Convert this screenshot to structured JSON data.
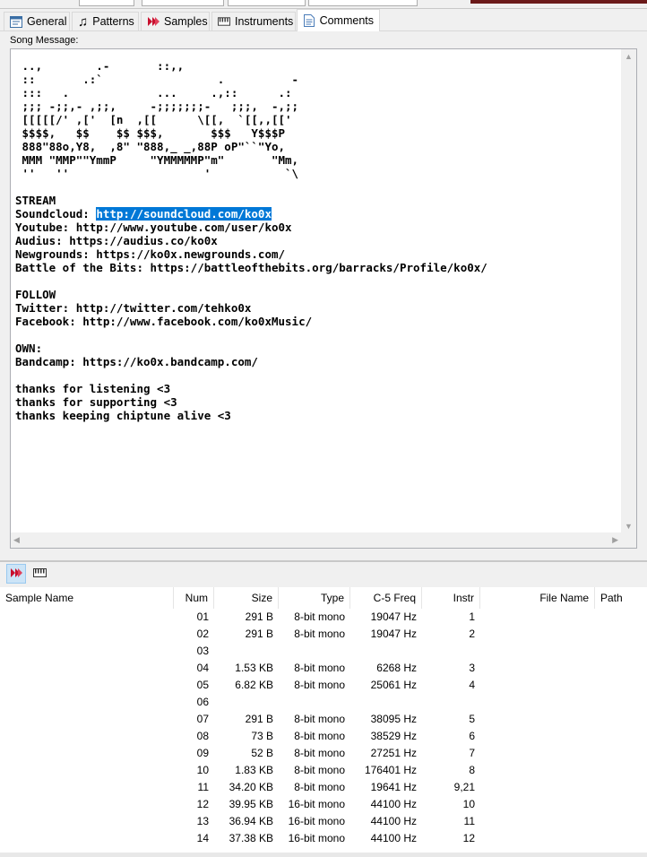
{
  "tabs": [
    {
      "label": "General",
      "icon": "general-icon",
      "active": false
    },
    {
      "label": "Patterns",
      "icon": "music-note-icon",
      "active": false
    },
    {
      "label": "Samples",
      "icon": "samples-icon",
      "active": false
    },
    {
      "label": "Instruments",
      "icon": "piano-icon",
      "active": false
    },
    {
      "label": "Comments",
      "icon": "document-icon",
      "active": true
    }
  ],
  "song_message_label": "Song Message:",
  "comment": {
    "ascii_art": " ..,        .-       ::,,\n ::       .:`                 .          -\n :::   .             ...     .,::      .:\n ;;; -;;,- ,;;,     -;;;;;;;-   ;;;,  -,;;\n [[[[[/' ,['  [n  ,[[      \\[[,  `[[,,[['\n $$$$,   $$    $$ $$$,       $$$   Y$$$P\n 888\"88o,Y8,  ,8\" \"888,_ _,88P oP\"``\"Yo,\n MMM \"MMP\"\"YmmP     \"YMMMMMP\"m\"       \"Mm,\n ''   ''                    '           `\\\n\n",
    "before_selection": "STREAM\nSoundcloud: ",
    "selection": "http://soundcloud.com/ko0x",
    "after_selection": "\nYoutube: http://www.youtube.com/user/ko0x\nAudius: https://audius.co/ko0x\nNewgrounds: https://ko0x.newgrounds.com/\nBattle of the Bits: https://battleofthebits.org/barracks/Profile/ko0x/\n\nFOLLOW\nTwitter: http://twitter.com/tehko0x\nFacebook: http://www.facebook.com/ko0xMusic/\n\nOWN:\nBandcamp: https://ko0x.bandcamp.com/\n\nthanks for listening <3\nthanks for supporting <3\nthanks keeping chiptune alive <3"
  },
  "list_columns": [
    "Sample Name",
    "Num",
    "Size",
    "Type",
    "C-5 Freq",
    "Instr",
    "File Name",
    "Path"
  ],
  "samples": [
    {
      "name": "",
      "num": "01",
      "size": "291 B",
      "type": "8-bit mono",
      "freq": "19047 Hz",
      "instr": "1",
      "file": "",
      "path": ""
    },
    {
      "name": "",
      "num": "02",
      "size": "291 B",
      "type": "8-bit mono",
      "freq": "19047 Hz",
      "instr": "2",
      "file": "",
      "path": ""
    },
    {
      "name": "",
      "num": "03",
      "size": "",
      "type": "",
      "freq": "",
      "instr": "",
      "file": "",
      "path": ""
    },
    {
      "name": "",
      "num": "04",
      "size": "1.53 KB",
      "type": "8-bit mono",
      "freq": "6268 Hz",
      "instr": "3",
      "file": "",
      "path": ""
    },
    {
      "name": "",
      "num": "05",
      "size": "6.82 KB",
      "type": "8-bit mono",
      "freq": "25061 Hz",
      "instr": "4",
      "file": "",
      "path": ""
    },
    {
      "name": "",
      "num": "06",
      "size": "",
      "type": "",
      "freq": "",
      "instr": "",
      "file": "",
      "path": ""
    },
    {
      "name": "",
      "num": "07",
      "size": "291 B",
      "type": "8-bit mono",
      "freq": "38095 Hz",
      "instr": "5",
      "file": "",
      "path": ""
    },
    {
      "name": "",
      "num": "08",
      "size": "73 B",
      "type": "8-bit mono",
      "freq": "38529 Hz",
      "instr": "6",
      "file": "",
      "path": ""
    },
    {
      "name": "",
      "num": "09",
      "size": "52 B",
      "type": "8-bit mono",
      "freq": "27251 Hz",
      "instr": "7",
      "file": "",
      "path": ""
    },
    {
      "name": "",
      "num": "10",
      "size": "1.83 KB",
      "type": "8-bit mono",
      "freq": "176401 Hz",
      "instr": "8",
      "file": "",
      "path": ""
    },
    {
      "name": "",
      "num": "11",
      "size": "34.20 KB",
      "type": "8-bit mono",
      "freq": "19641 Hz",
      "instr": "9,21",
      "file": "",
      "path": ""
    },
    {
      "name": "",
      "num": "12",
      "size": "39.95 KB",
      "type": "16-bit mono",
      "freq": "44100 Hz",
      "instr": "10",
      "file": "",
      "path": ""
    },
    {
      "name": "",
      "num": "13",
      "size": "36.94 KB",
      "type": "16-bit mono",
      "freq": "44100 Hz",
      "instr": "11",
      "file": "",
      "path": ""
    },
    {
      "name": "",
      "num": "14",
      "size": "37.38 KB",
      "type": "16-bit mono",
      "freq": "44100 Hz",
      "instr": "12",
      "file": "",
      "path": ""
    }
  ],
  "colors": {
    "selection": "#0078d7",
    "samples_icon": "#c8102e",
    "title_bar_remnant": "#6b1a1a"
  }
}
